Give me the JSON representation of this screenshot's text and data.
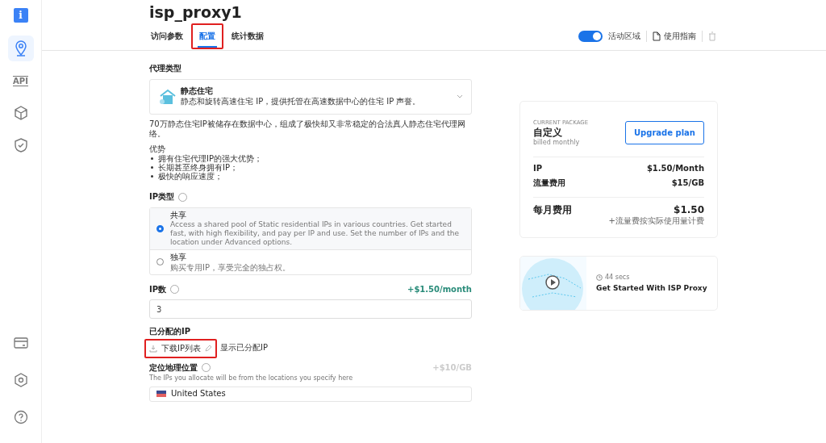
{
  "sidebar": {
    "logo": {
      "label": "i"
    },
    "items": [
      {
        "kind": "location",
        "selected": true
      },
      {
        "kind": "api",
        "label": "API",
        "selected": false
      },
      {
        "kind": "layers",
        "selected": false
      },
      {
        "kind": "shield",
        "selected": false
      }
    ],
    "bottom_items": [
      {
        "kind": "card",
        "selected": false
      },
      {
        "kind": "gear",
        "selected": false
      },
      {
        "kind": "help",
        "selected": false
      }
    ]
  },
  "header": {
    "title": "isp_proxy1",
    "tabs": [
      {
        "label": "访问参数",
        "selected": false,
        "highlighted": false
      },
      {
        "label": "配置",
        "selected": true,
        "highlighted": true
      },
      {
        "label": "统计数据",
        "selected": false,
        "highlighted": false
      }
    ],
    "toggle": {
      "label": "活动区域",
      "on": true
    },
    "guide": "使用指南",
    "delete_disabled": true
  },
  "proxy_type": {
    "label": "代理类型",
    "option": {
      "title": "静态住宅",
      "description": "静态和旋转高速住宅 IP，提供托管在高速数据中心的住宅 IP 声誉。"
    },
    "note": "70万静态住宅IP被储存在数据中心，组成了极快却又非常稳定的合法真人静态住宅代理网络。",
    "advantages_title": "优势",
    "advantages": [
      "拥有住宅代理IP的强大优势；",
      "长期甚至终身拥有IP；",
      "极快的响应速度；"
    ]
  },
  "ip_type": {
    "label": "IP类型",
    "options": [
      {
        "title": "共享",
        "description": "Access a shared pool of Static residential IPs in various countries. Get started fast, with high flexibility, and pay per IP and use. Set the number of IPs and the location under Advanced options.",
        "selected": true
      },
      {
        "title": "独享",
        "description": "购买专用IP，享受完全的独占权。",
        "selected": false
      }
    ]
  },
  "ip_count": {
    "label": "IP数",
    "price": "+$1.50/month",
    "value": "3"
  },
  "assigned_ip": {
    "label": "已分配的IP",
    "download": "下载IP列表",
    "download_highlighted": true,
    "show": "显示已分配IP"
  },
  "geo": {
    "label": "定位地理位置",
    "price": "+$10/GB",
    "hint": "The IPs you allocate will be from the locations you specify here",
    "location": "United States"
  },
  "package": {
    "caption": "CURRENT PACKAGE",
    "name": "自定义",
    "billing": "billed monthly",
    "button": "Upgrade plan",
    "rows": [
      {
        "label": "IP",
        "value": "$1.50/Month"
      },
      {
        "label": "流量费用",
        "value": "$15/GB"
      }
    ],
    "total_label": "每月费用",
    "total": "$1.50",
    "total_note": "+流量费按实际使用量计费"
  },
  "video": {
    "duration": "44 secs",
    "title": "Get Started With ISP Proxy"
  }
}
